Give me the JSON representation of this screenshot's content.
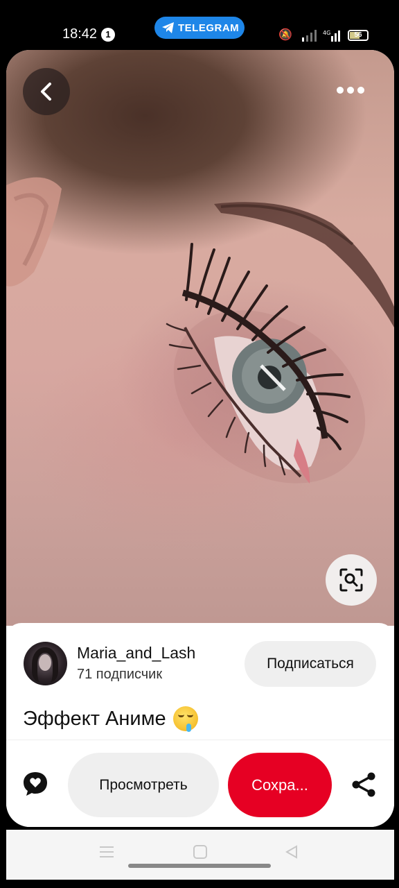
{
  "status_bar": {
    "time": "18:42",
    "notification_count": "1",
    "telegram_label": "TELEGRAM",
    "battery_level": "56",
    "accent_color": "#1e86e8"
  },
  "pin": {
    "back_icon": "chevron-left-icon",
    "more_icon": "more-horizontal-icon",
    "visual_search_icon": "visual-search-icon",
    "author": {
      "name": "Maria_and_Lash",
      "followers": "71 подписчик"
    },
    "follow_label": "Подписаться",
    "title": "Эффект Аниме",
    "title_emoji": "drooling-face-emoji"
  },
  "actions": {
    "comment_icon": "comment-icon",
    "view_label": "Просмотреть",
    "save_label": "Сохра...",
    "save_color": "#e60023",
    "share_icon": "share-icon"
  },
  "nav_bar": {
    "menu_icon": "menu-icon",
    "home_icon": "home-icon",
    "back_icon": "back-triangle-icon"
  }
}
